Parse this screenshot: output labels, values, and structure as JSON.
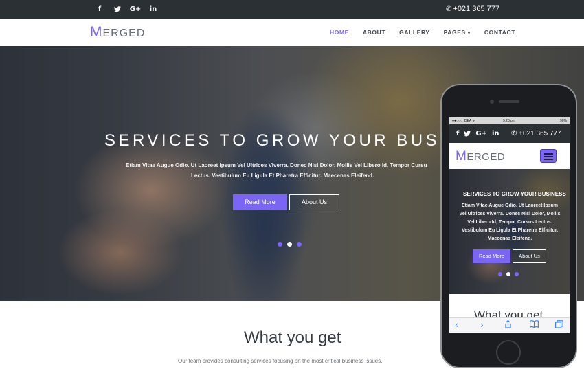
{
  "topbar": {
    "social": [
      {
        "icon": "facebook-icon",
        "glyph": "f"
      },
      {
        "icon": "twitter-icon",
        "glyph": "🐦"
      },
      {
        "icon": "google-plus-icon",
        "glyph": "G+"
      },
      {
        "icon": "linkedin-icon",
        "glyph": "in"
      }
    ],
    "phone_icon": "✆",
    "phone": "+021 365 777"
  },
  "navbar": {
    "logo_initial": "M",
    "logo_rest": "ERGED",
    "items": [
      {
        "label": "HOME",
        "active": true
      },
      {
        "label": "ABOUT",
        "active": false
      },
      {
        "label": "GALLERY",
        "active": false
      },
      {
        "label": "PAGES",
        "active": false,
        "caret": "▾"
      },
      {
        "label": "CONTACT",
        "active": false
      }
    ]
  },
  "hero": {
    "title": "SERVICES TO GROW YOUR BUSINE",
    "subtitle_line1": "Etiam Vitae Augue Odio. Ut Laoreet Ipsum Vel Ultrices Viverra. Donec Nisl Dolor, Mollis Vel Libero Id, Tempor Cursu",
    "subtitle_line2": "Lectus. Vestibulum Eu Ligula Et Pharetra Efficitur. Maecenas Eleifend.",
    "read_more": "Read More",
    "about_us": "About Us",
    "active_slide": 2,
    "slide_count": 3
  },
  "section": {
    "title": "What you get",
    "description": "Our team provides consulting services focusing on the most critical business issues."
  },
  "phone_mockup": {
    "status_left": "●●○○○ IDEA ᯤ",
    "status_time": "9:20 pm",
    "status_right": "90%",
    "phone": "+021 365 777",
    "logo_initial": "M",
    "logo_rest": "ERGED",
    "hero_title": "SERVICES TO GROW YOUR BUSINESS",
    "hero_desc": "Etiam Vitae Augue Odio. Ut Laoreet Ipsum Vel Ultrices Viverra. Donec Nisl Dolor, Mollis Vel Libero Id, Tempor Cursus Lectus. Vestibulum Eu Ligula Et Pharetra Efficitur. Maecenas Eleifend.",
    "read_more": "Read More",
    "about_us": "About Us",
    "section_title": "What you get",
    "toolbar_icons": [
      "back-icon",
      "forward-icon",
      "share-icon",
      "bookmarks-icon",
      "tabs-icon"
    ]
  },
  "colors": {
    "accent": "#7b65f5",
    "topbar": "#2b3035",
    "text_dark": "#333a40"
  }
}
